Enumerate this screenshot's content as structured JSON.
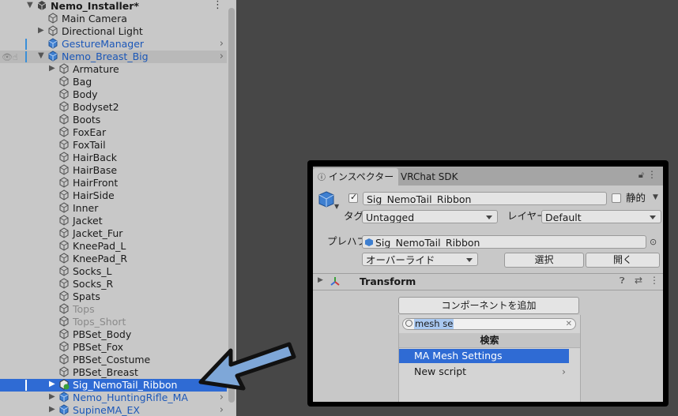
{
  "hierarchy": {
    "root": "Nemo_Installer*",
    "items": [
      "Main Camera",
      "Directional Light",
      "GestureManager",
      "Nemo_Breast_Big",
      "Armature",
      "Bag",
      "Body",
      "Bodyset2",
      "Boots",
      "FoxEar",
      "FoxTail",
      "HairBack",
      "HairBase",
      "HairFront",
      "HairSide",
      "Inner",
      "Jacket",
      "Jacket_Fur",
      "KneePad_L",
      "KneePad_R",
      "Socks_L",
      "Socks_R",
      "Spats",
      "Tops",
      "Tops_Short",
      "PBSet_Body",
      "PBSet_Fox",
      "PBSet_Costume",
      "PBSet_Breast",
      "Sig_NemoTail_Ribbon",
      "Nemo_HuntingRifle_MA",
      "SupineMA_EX"
    ]
  },
  "inspector": {
    "tabs": [
      "インスペクター",
      "VRChat SDK"
    ],
    "object_name": "Sig_NemoTail_Ribbon",
    "static_label": "静的",
    "tag_label": "タグ",
    "tag_value": "Untagged",
    "layer_label": "レイヤー",
    "layer_value": "Default",
    "prefab_label": "プレハブ",
    "prefab_value": "Sig_NemoTail_Ribbon",
    "overrides": "オーバーライド",
    "select": "選択",
    "open": "開く",
    "component": "Transform",
    "add_component": "コンポーネントを追加",
    "search_query": "mesh se",
    "search_header": "検索",
    "results": [
      "MA Mesh Settings",
      "New script"
    ]
  }
}
